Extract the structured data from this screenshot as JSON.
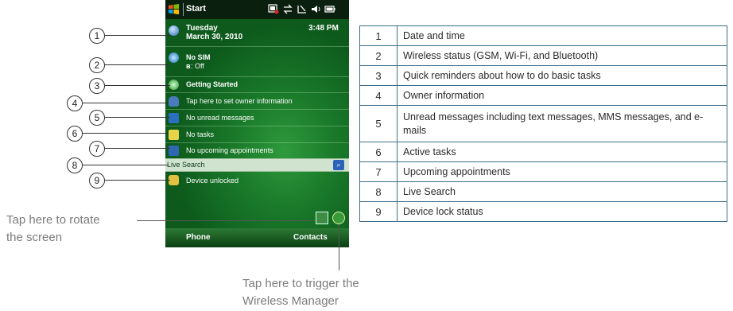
{
  "phone": {
    "status_title": "Start",
    "day": "Tuesday",
    "date": "March 30, 2010",
    "time": "3:48 PM",
    "sim": "No SIM",
    "bluetooth": ": Off",
    "getting_started": "Getting Started",
    "owner": "Tap here to set owner information",
    "messages": "No unread messages",
    "tasks": "No tasks",
    "appointments": "No upcoming appointments",
    "search_label": "Live Search",
    "lock": "Device unlocked",
    "softkey_left": "Phone",
    "softkey_right": "Contacts"
  },
  "callouts": [
    "1",
    "2",
    "3",
    "4",
    "5",
    "6",
    "7",
    "8",
    "9"
  ],
  "notes": {
    "rotate_line1": "Tap here to rotate",
    "rotate_line2": "the screen",
    "wireless_line1": "Tap here to trigger the",
    "wireless_line2": "Wireless Manager"
  },
  "legend": [
    {
      "num": "1",
      "text": "Date and time"
    },
    {
      "num": "2",
      "text": "Wireless status (GSM, Wi-Fi, and Bluetooth)"
    },
    {
      "num": "3",
      "text": "Quick reminders about how to do basic tasks"
    },
    {
      "num": "4",
      "text": "Owner information"
    },
    {
      "num": "5",
      "text": "Unread messages including text messages, MMS messages, and e-mails"
    },
    {
      "num": "6",
      "text": "Active tasks"
    },
    {
      "num": "7",
      "text": "Upcoming appointments"
    },
    {
      "num": "8",
      "text": "Live Search"
    },
    {
      "num": "9",
      "text": "Device lock status"
    }
  ],
  "colors": {
    "screen_green": "#1a7a2a",
    "table_border": "#3d6d8a",
    "note_gray": "#7b7b7b"
  }
}
